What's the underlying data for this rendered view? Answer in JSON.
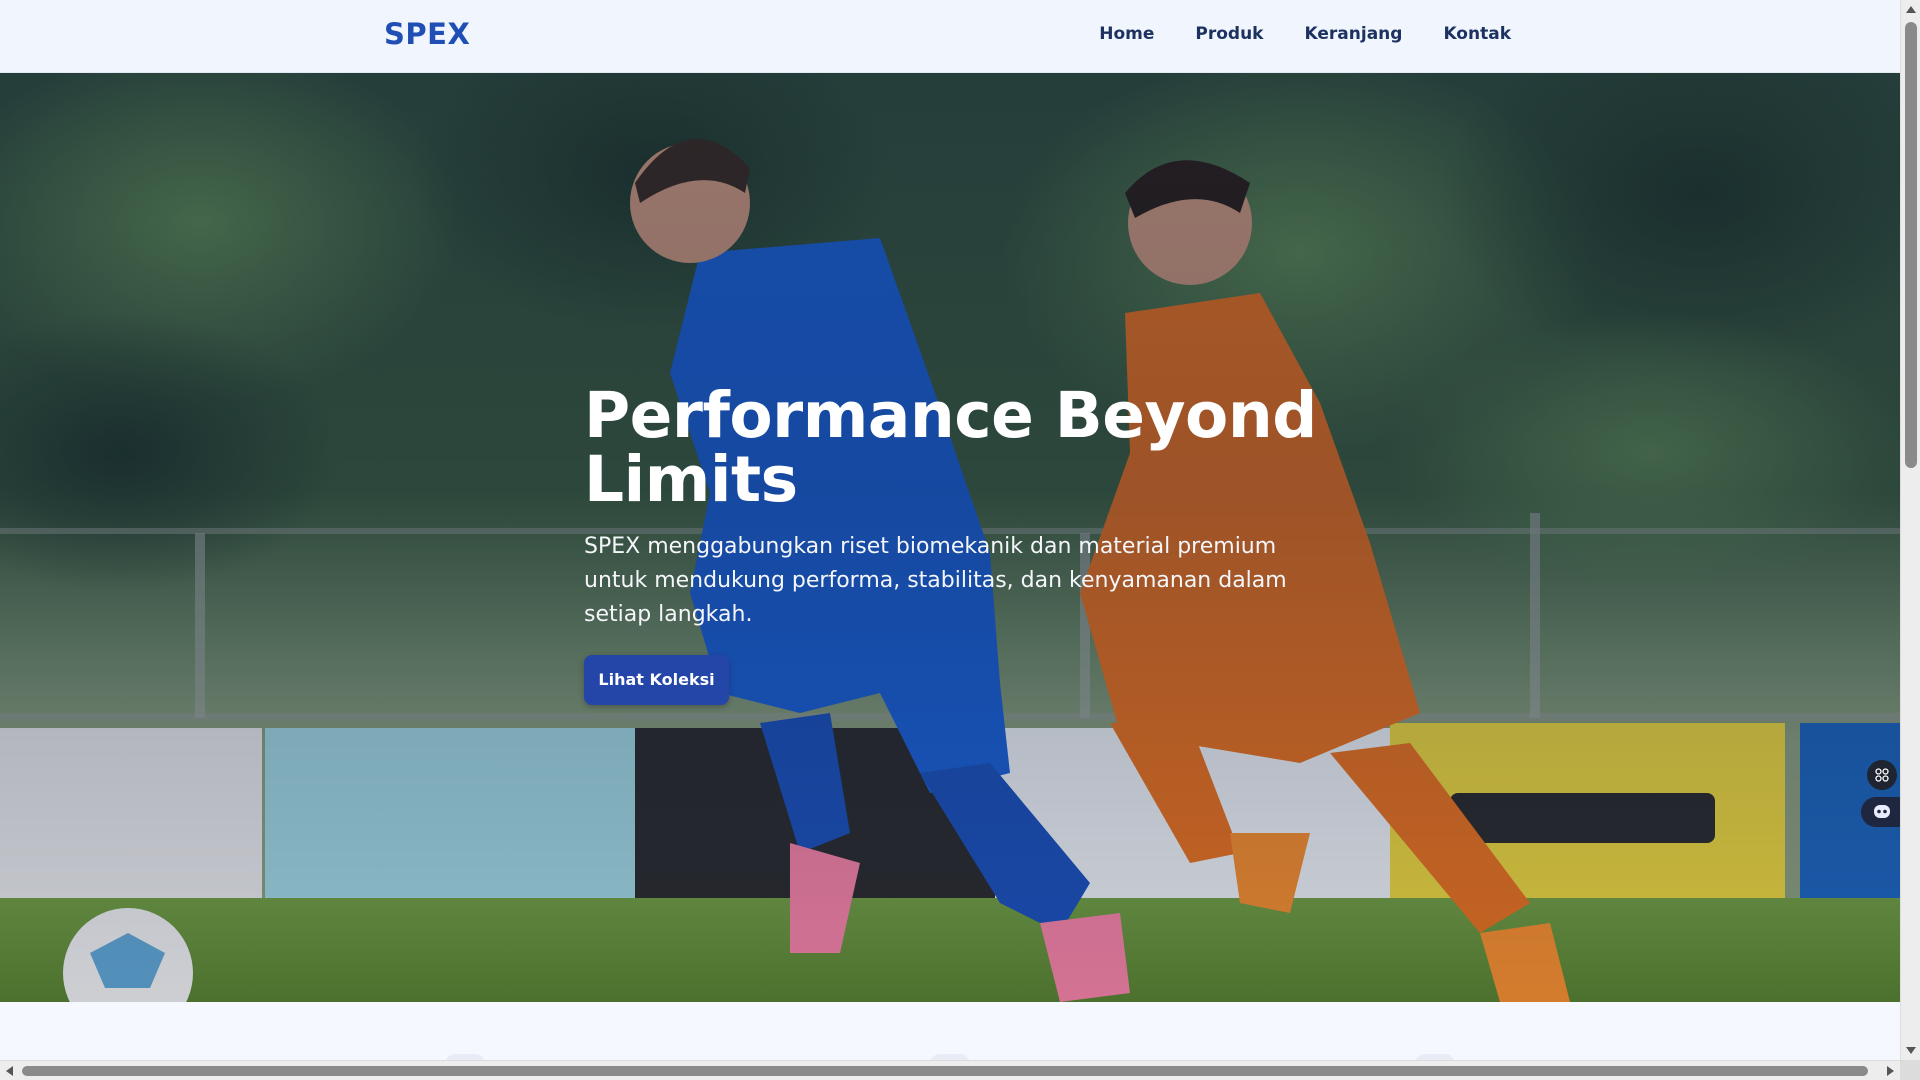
{
  "nav": {
    "logo": "SPEX",
    "links": [
      "Home",
      "Produk",
      "Keranjang",
      "Kontak"
    ]
  },
  "hero": {
    "title": "Performance Beyond Limits",
    "description": "SPEX menggabungkan riset biomekanik dan material premium untuk mendukung performa, stabilitas, dan kenyamanan dalam setiap langkah.",
    "button_label": "Lihat Koleksi",
    "image_semantic": "soccer-players-running-photo"
  },
  "colors": {
    "brand": "#1f4fb5",
    "nav_bg": "#f1f5fd",
    "button_bg": "#2446a8",
    "text_dark": "#1d3260"
  },
  "floating": {
    "icons": [
      "grid-icon",
      "chat-bot-icon"
    ]
  }
}
